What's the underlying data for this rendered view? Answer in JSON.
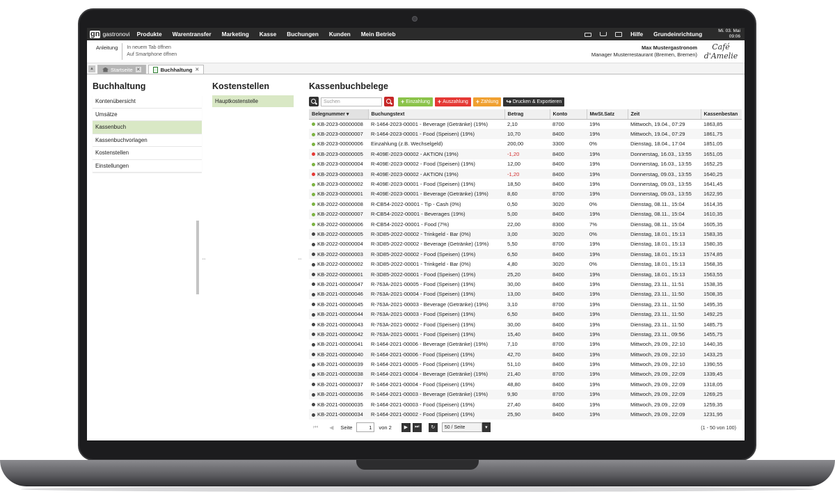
{
  "topbar": {
    "logo_mark": "gn",
    "logo_text": "gastronovi",
    "nav": [
      "Produkte",
      "Warentransfer",
      "Marketing",
      "Kasse",
      "Buchungen",
      "Kunden",
      "Mein Betrieb"
    ],
    "hilfe": "Hilfe",
    "grundeinrichtung": "Grundeinrichtung",
    "date": "Mi. 03. Mai",
    "time": "09:06"
  },
  "subheader": {
    "anleitung": "Anleitung",
    "link1": "In neuem Tab öffnen",
    "link2": "Auf Smartphone öffnen",
    "user_name": "Max Mustergastronom",
    "user_role": "Manager Musterrestaurant (Bremen, Bremen)",
    "cafe_logo": "Café d'Amelie"
  },
  "tabs": [
    {
      "label": "Startseite"
    },
    {
      "label": "Buchhaltung"
    }
  ],
  "left": {
    "title": "Buchhaltung",
    "items": [
      "Kontenübersicht",
      "Umsätze",
      "Kassenbuch",
      "Kassenbuchvorlagen",
      "Kostenstellen",
      "Einstellungen"
    ]
  },
  "mid": {
    "title": "Kostenstellen",
    "item": "Hauptkostenstelle"
  },
  "main": {
    "title": "Kassenbuchbelege",
    "search_placeholder": "Suchen",
    "buttons": {
      "einzahlung": "Einzahlung",
      "auszahlung": "Auszahlung",
      "zaehlung": "Zählung",
      "drucken": "Drucken & Exportieren"
    },
    "columns": [
      "Belegnummer",
      "Buchungstext",
      "Betrag",
      "Konto",
      "MwSt.Satz",
      "Zeit",
      "Kassenbestan"
    ],
    "rows": [
      {
        "status": "#7cb342",
        "nr": "KB-2023-00000008",
        "text": "R-1464-2023-00001 - Beverage (Getränke) (19%)",
        "betrag": "2,10",
        "konto": "8700",
        "mwst": "19%",
        "zeit": "Mittwoch, 19.04., 07:29",
        "bestand": "1863,85"
      },
      {
        "status": "#7cb342",
        "nr": "KB-2023-00000007",
        "text": "R-1464-2023-00001 - Food (Speisen) (19%)",
        "betrag": "10,70",
        "konto": "8400",
        "mwst": "19%",
        "zeit": "Mittwoch, 19.04., 07:29",
        "bestand": "1861,75"
      },
      {
        "status": "#7cb342",
        "nr": "KB-2023-00000006",
        "text": "Einzahlung (z.B. Wechselgeld)",
        "betrag": "200,00",
        "konto": "3300",
        "mwst": "0%",
        "zeit": "Dienstag, 18.04., 17:04",
        "bestand": "1851,05"
      },
      {
        "status": "#e53935",
        "nr": "KB-2023-00000005",
        "text": "R-409E-2023-00002 - AKTION (19%)",
        "betrag": "-1,20",
        "konto": "8400",
        "mwst": "19%",
        "zeit": "Donnerstag, 16.03., 13:55",
        "bestand": "1651,05"
      },
      {
        "status": "#7cb342",
        "nr": "KB-2023-00000004",
        "text": "R-409E-2023-00002 - Food (Speisen) (19%)",
        "betrag": "12,00",
        "konto": "8400",
        "mwst": "19%",
        "zeit": "Donnerstag, 16.03., 13:55",
        "bestand": "1652,25"
      },
      {
        "status": "#e53935",
        "nr": "KB-2023-00000003",
        "text": "R-409E-2023-00002 - AKTION (19%)",
        "betrag": "-1,20",
        "konto": "8400",
        "mwst": "19%",
        "zeit": "Donnerstag, 09.03., 13:55",
        "bestand": "1640,25"
      },
      {
        "status": "#7cb342",
        "nr": "KB-2023-00000002",
        "text": "R-409E-2023-00001 - Food (Speisen) (19%)",
        "betrag": "18,50",
        "konto": "8400",
        "mwst": "19%",
        "zeit": "Donnerstag, 09.03., 13:55",
        "bestand": "1641,45"
      },
      {
        "status": "#7cb342",
        "nr": "KB-2023-00000001",
        "text": "R-409E-2023-00001 - Beverage (Getränke) (19%)",
        "betrag": "8,60",
        "konto": "8700",
        "mwst": "19%",
        "zeit": "Donnerstag, 09.03., 13:55",
        "bestand": "1622,95"
      },
      {
        "status": "#7cb342",
        "nr": "KB-2022-00000008",
        "text": "R-CB54-2022-00001 - Tip - Cash (0%)",
        "betrag": "0,50",
        "konto": "3020",
        "mwst": "0%",
        "zeit": "Dienstag, 08.11., 15:04",
        "bestand": "1614,35"
      },
      {
        "status": "#7cb342",
        "nr": "KB-2022-00000007",
        "text": "R-CB54-2022-00001 - Beverages (19%)",
        "betrag": "5,00",
        "konto": "8400",
        "mwst": "19%",
        "zeit": "Dienstag, 08.11., 15:04",
        "bestand": "1610,35"
      },
      {
        "status": "#7cb342",
        "nr": "KB-2022-00000006",
        "text": "R-CB54-2022-00001 - Food (7%)",
        "betrag": "22,00",
        "konto": "8300",
        "mwst": "7%",
        "zeit": "Dienstag, 08.11., 15:04",
        "bestand": "1605,35"
      },
      {
        "status": "#444444",
        "nr": "KB-2022-00000005",
        "text": "R-3D85-2022-00002 - Trinkgeld - Bar (0%)",
        "betrag": "3,00",
        "konto": "3020",
        "mwst": "0%",
        "zeit": "Dienstag, 18.01., 15:13",
        "bestand": "1583,35"
      },
      {
        "status": "#444444",
        "nr": "KB-2022-00000004",
        "text": "R-3D85-2022-00002 - Beverage (Getränke) (19%)",
        "betrag": "5,50",
        "konto": "8700",
        "mwst": "19%",
        "zeit": "Dienstag, 18.01., 15:13",
        "bestand": "1580,35"
      },
      {
        "status": "#444444",
        "nr": "KB-2022-00000003",
        "text": "R-3D85-2022-00002 - Food (Speisen) (19%)",
        "betrag": "6,50",
        "konto": "8400",
        "mwst": "19%",
        "zeit": "Dienstag, 18.01., 15:13",
        "bestand": "1574,85"
      },
      {
        "status": "#444444",
        "nr": "KB-2022-00000002",
        "text": "R-3D85-2022-00001 - Trinkgeld - Bar (0%)",
        "betrag": "4,80",
        "konto": "3020",
        "mwst": "0%",
        "zeit": "Dienstag, 18.01., 15:13",
        "bestand": "1568,35"
      },
      {
        "status": "#444444",
        "nr": "KB-2022-00000001",
        "text": "R-3D85-2022-00001 - Food (Speisen) (19%)",
        "betrag": "25,20",
        "konto": "8400",
        "mwst": "19%",
        "zeit": "Dienstag, 18.01., 15:13",
        "bestand": "1563,55"
      },
      {
        "status": "#444444",
        "nr": "KB-2021-00000047",
        "text": "R-763A-2021-00005 - Food (Speisen) (19%)",
        "betrag": "30,00",
        "konto": "8400",
        "mwst": "19%",
        "zeit": "Dienstag, 23.11., 11:51",
        "bestand": "1538,35"
      },
      {
        "status": "#444444",
        "nr": "KB-2021-00000046",
        "text": "R-763A-2021-00004 - Food (Speisen) (19%)",
        "betrag": "13,00",
        "konto": "8400",
        "mwst": "19%",
        "zeit": "Dienstag, 23.11., 11:50",
        "bestand": "1508,35"
      },
      {
        "status": "#444444",
        "nr": "KB-2021-00000045",
        "text": "R-763A-2021-00003 - Beverage (Getränke) (19%)",
        "betrag": "3,10",
        "konto": "8700",
        "mwst": "19%",
        "zeit": "Dienstag, 23.11., 11:50",
        "bestand": "1495,35"
      },
      {
        "status": "#444444",
        "nr": "KB-2021-00000044",
        "text": "R-763A-2021-00003 - Food (Speisen) (19%)",
        "betrag": "6,50",
        "konto": "8400",
        "mwst": "19%",
        "zeit": "Dienstag, 23.11., 11:50",
        "bestand": "1492,25"
      },
      {
        "status": "#444444",
        "nr": "KB-2021-00000043",
        "text": "R-763A-2021-00002 - Food (Speisen) (19%)",
        "betrag": "30,00",
        "konto": "8400",
        "mwst": "19%",
        "zeit": "Dienstag, 23.11., 11:50",
        "bestand": "1485,75"
      },
      {
        "status": "#444444",
        "nr": "KB-2021-00000042",
        "text": "R-763A-2021-00001 - Food (Speisen) (19%)",
        "betrag": "15,40",
        "konto": "8400",
        "mwst": "19%",
        "zeit": "Dienstag, 23.11., 09:56",
        "bestand": "1455,75"
      },
      {
        "status": "#444444",
        "nr": "KB-2021-00000041",
        "text": "R-1464-2021-00006 - Beverage (Getränke) (19%)",
        "betrag": "7,10",
        "konto": "8700",
        "mwst": "19%",
        "zeit": "Mittwoch, 29.09., 22:10",
        "bestand": "1440,35"
      },
      {
        "status": "#444444",
        "nr": "KB-2021-00000040",
        "text": "R-1464-2021-00006 - Food (Speisen) (19%)",
        "betrag": "42,70",
        "konto": "8400",
        "mwst": "19%",
        "zeit": "Mittwoch, 29.09., 22:10",
        "bestand": "1433,25"
      },
      {
        "status": "#444444",
        "nr": "KB-2021-00000039",
        "text": "R-1464-2021-00005 - Food (Speisen) (19%)",
        "betrag": "51,10",
        "konto": "8400",
        "mwst": "19%",
        "zeit": "Mittwoch, 29.09., 22:10",
        "bestand": "1390,55"
      },
      {
        "status": "#444444",
        "nr": "KB-2021-00000038",
        "text": "R-1464-2021-00004 - Beverage (Getränke) (19%)",
        "betrag": "21,40",
        "konto": "8700",
        "mwst": "19%",
        "zeit": "Mittwoch, 29.09., 22:09",
        "bestand": "1339,45"
      },
      {
        "status": "#444444",
        "nr": "KB-2021-00000037",
        "text": "R-1464-2021-00004 - Food (Speisen) (19%)",
        "betrag": "48,80",
        "konto": "8400",
        "mwst": "19%",
        "zeit": "Mittwoch, 29.09., 22:09",
        "bestand": "1318,05"
      },
      {
        "status": "#444444",
        "nr": "KB-2021-00000036",
        "text": "R-1464-2021-00003 - Beverage (Getränke) (19%)",
        "betrag": "9,90",
        "konto": "8700",
        "mwst": "19%",
        "zeit": "Mittwoch, 29.09., 22:09",
        "bestand": "1269,25"
      },
      {
        "status": "#444444",
        "nr": "KB-2021-00000035",
        "text": "R-1464-2021-00003 - Food (Speisen) (19%)",
        "betrag": "27,40",
        "konto": "8400",
        "mwst": "19%",
        "zeit": "Mittwoch, 29.09., 22:09",
        "bestand": "1259,35"
      },
      {
        "status": "#444444",
        "nr": "KB-2021-00000034",
        "text": "R-1464-2021-00002 - Food (Speisen) (19%)",
        "betrag": "25,90",
        "konto": "8400",
        "mwst": "19%",
        "zeit": "Mittwoch, 29.09., 22:09",
        "bestand": "1231,95"
      }
    ],
    "pager": {
      "seite_label": "Seite",
      "page": "1",
      "von_label": "von 2",
      "per_page": "50 / Seite",
      "count": "(1 - 50 von 100)"
    }
  }
}
